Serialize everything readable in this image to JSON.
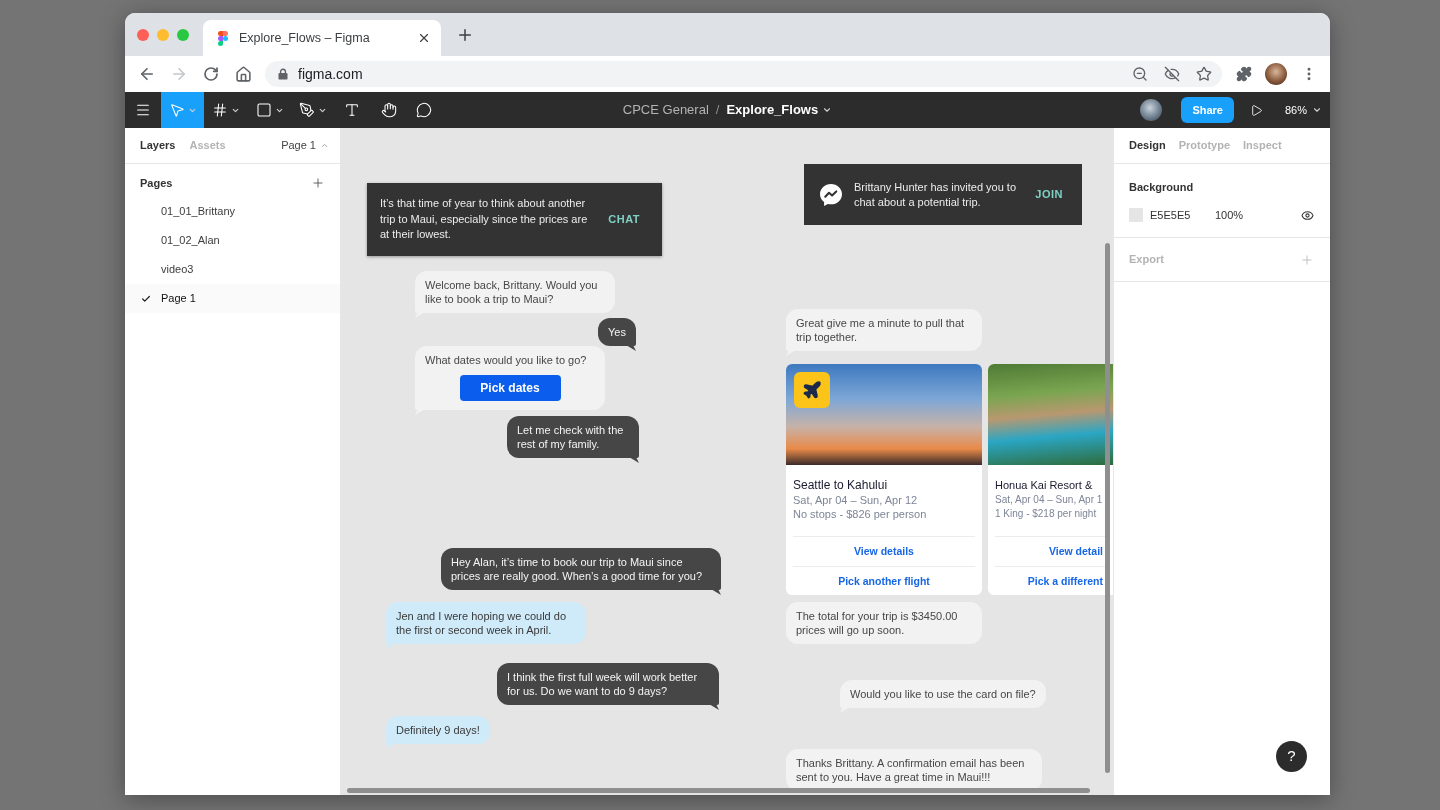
{
  "browser": {
    "tab_title": "Explore_Flows – Figma",
    "forward_disabled": true,
    "address": "figma.com"
  },
  "toolbar": {
    "tools": [
      {
        "kind": "move",
        "selected": true
      },
      {
        "kind": "frame",
        "selected": false
      },
      {
        "kind": "shape",
        "selected": false
      },
      {
        "kind": "pen",
        "selected": false
      },
      {
        "kind": "text",
        "selected": false
      },
      {
        "kind": "hand",
        "selected": false
      },
      {
        "kind": "comment",
        "selected": false
      }
    ],
    "team": "CPCE General",
    "separator": "/",
    "file_name": "Explore_Flows",
    "share": "Share",
    "zoom": "86%"
  },
  "left_panel": {
    "tabs": [
      {
        "label": "Layers",
        "selected": true
      },
      {
        "label": "Assets",
        "selected": false
      }
    ],
    "page_menu": "Page 1",
    "pages_title": "Pages",
    "pages": [
      {
        "label": "01_01_Brittany",
        "selected": false
      },
      {
        "label": "01_02_Alan",
        "selected": false
      },
      {
        "label": "video3",
        "selected": false
      },
      {
        "label": "Page 1",
        "selected": true
      }
    ]
  },
  "canvas": {
    "notifications": [
      {
        "kind": "plain",
        "text": "It’s that time of year to think about another trip to Maui, especially since the prices are at their lowest.",
        "action": "CHAT"
      },
      {
        "kind": "invite",
        "text": "Brittany Hunter has invited you to chat about a potential trip.",
        "action": "JOIN"
      }
    ],
    "conversations": [
      {
        "messages": [
          {
            "kind": "received",
            "tail": true,
            "text": "Welcome back, Brittany. Would you like to book a trip to Maui?"
          },
          {
            "kind": "sent",
            "tail": true,
            "text": "Yes"
          },
          {
            "kind": "received",
            "tail": true,
            "text": "What dates would you like to go?",
            "button": "Pick dates"
          },
          {
            "kind": "sent",
            "tail": true,
            "text": "Let me check with the rest of my family."
          }
        ]
      },
      {
        "messages": [
          {
            "kind": "sent",
            "tail": true,
            "text": "Hey Alan, it’s time to book our trip to Maui since prices are really good. When’s a good time for you?"
          },
          {
            "kind": "friend",
            "tail": true,
            "text": "Jen and I were hoping we could do the first or second week in April."
          },
          {
            "kind": "sent",
            "tail": true,
            "text": "I think the first full week will work better for us. Do we want to do 9 days?"
          },
          {
            "kind": "friend",
            "tail": true,
            "text": "Definitely 9 days!"
          }
        ]
      },
      {
        "messages": [
          {
            "kind": "received",
            "tail": true,
            "text": "Great give me a minute to pull that trip together."
          },
          {
            "kind": "cards",
            "cards": [
              {
                "badge": true,
                "title": "Seattle to Kahului",
                "dates": "Sat, Apr 04 – Sun, Apr 12",
                "details": "No stops - $826 per person",
                "actions": [
                  "View details",
                  "Pick another flight"
                ]
              },
              {
                "badge": false,
                "title": "Honua Kai Resort &",
                "dates": "Sat, Apr 04 – Sun, Apr 1",
                "details": "1 King - $218 per night",
                "actions": [
                  "View detail",
                  "Pick a different"
                ]
              }
            ]
          },
          {
            "kind": "received",
            "tail": false,
            "text": "The total for your trip is $3450.00 prices will go up soon."
          },
          {
            "kind": "received",
            "tail": true,
            "text": "Would you like to use the card on file?"
          },
          {
            "kind": "received",
            "tail": false,
            "text": "Thanks Brittany. A confirmation email has been sent to you. Have a great time in Maui!!!"
          }
        ]
      }
    ]
  },
  "right_panel": {
    "tabs": [
      {
        "label": "Design",
        "selected": true
      },
      {
        "label": "Prototype",
        "selected": false
      },
      {
        "label": "Inspect",
        "selected": false
      }
    ],
    "background": {
      "title": "Background",
      "hex": "E5E5E5",
      "opacity": "100%"
    },
    "export": {
      "title": "Export"
    }
  },
  "help": "?"
}
